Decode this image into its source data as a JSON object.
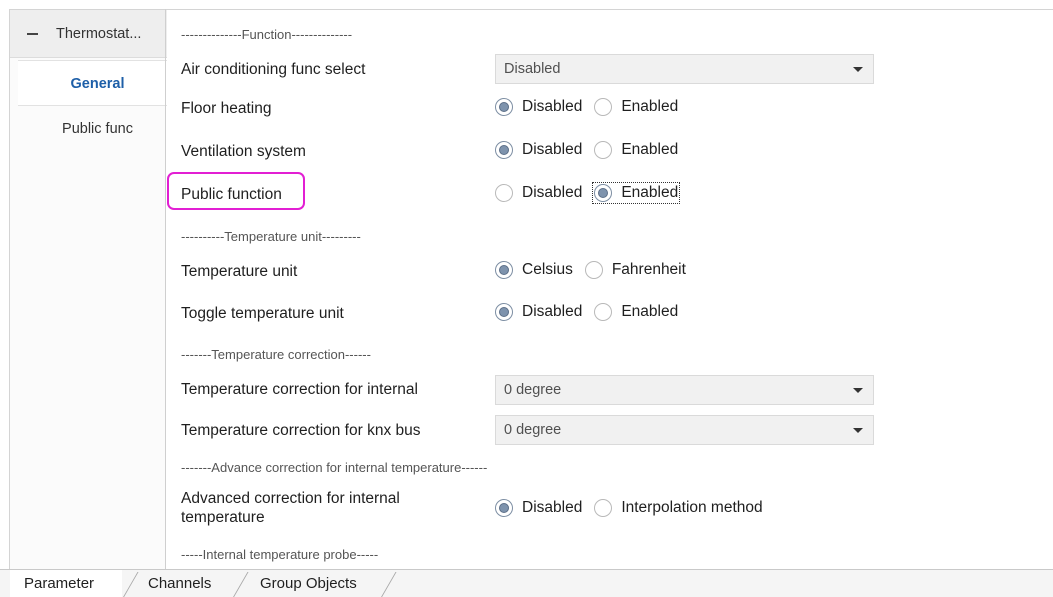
{
  "tree": {
    "header_label": "Thermostat...",
    "items": [
      {
        "label": "General",
        "selected": true
      },
      {
        "label": "Public func",
        "selected": false
      }
    ]
  },
  "sections": {
    "function": "--------------Function--------------",
    "temperature_unit": "----------Temperature unit---------",
    "temperature_correction": "-------Temperature correction------",
    "advance_correction": "-------Advance correction for internal temperature------",
    "internal_probe": "-----Internal temperature probe-----"
  },
  "fields": {
    "air_conditioning": {
      "label": "Air conditioning func select",
      "value": "Disabled"
    },
    "floor_heating": {
      "label": "Floor heating",
      "options": [
        "Disabled",
        "Enabled"
      ],
      "selected": "Disabled"
    },
    "ventilation": {
      "label": "Ventilation system",
      "options": [
        "Disabled",
        "Enabled"
      ],
      "selected": "Disabled"
    },
    "public_function": {
      "label": "Public function",
      "options": [
        "Disabled",
        "Enabled"
      ],
      "selected": "Enabled"
    },
    "temperature_unit": {
      "label": "Temperature unit",
      "options": [
        "Celsius",
        "Fahrenheit"
      ],
      "selected": "Celsius"
    },
    "toggle_unit": {
      "label": "Toggle temperature unit",
      "options": [
        "Disabled",
        "Enabled"
      ],
      "selected": "Disabled"
    },
    "correction_internal": {
      "label": "Temperature correction for internal",
      "value": "0 degree"
    },
    "correction_knx": {
      "label": "Temperature correction for knx bus",
      "value": "0 degree"
    },
    "advanced_correction": {
      "label": "Advanced correction for internal temperature",
      "options": [
        "Disabled",
        "Interpolation method"
      ],
      "selected": "Disabled"
    }
  },
  "tabs": [
    "Parameter",
    "Channels",
    "Group Objects"
  ],
  "colors": {
    "highlight": "#e21fd3",
    "selected_nav": "#1e5fa8",
    "radio_checked": "#7e93ad"
  }
}
